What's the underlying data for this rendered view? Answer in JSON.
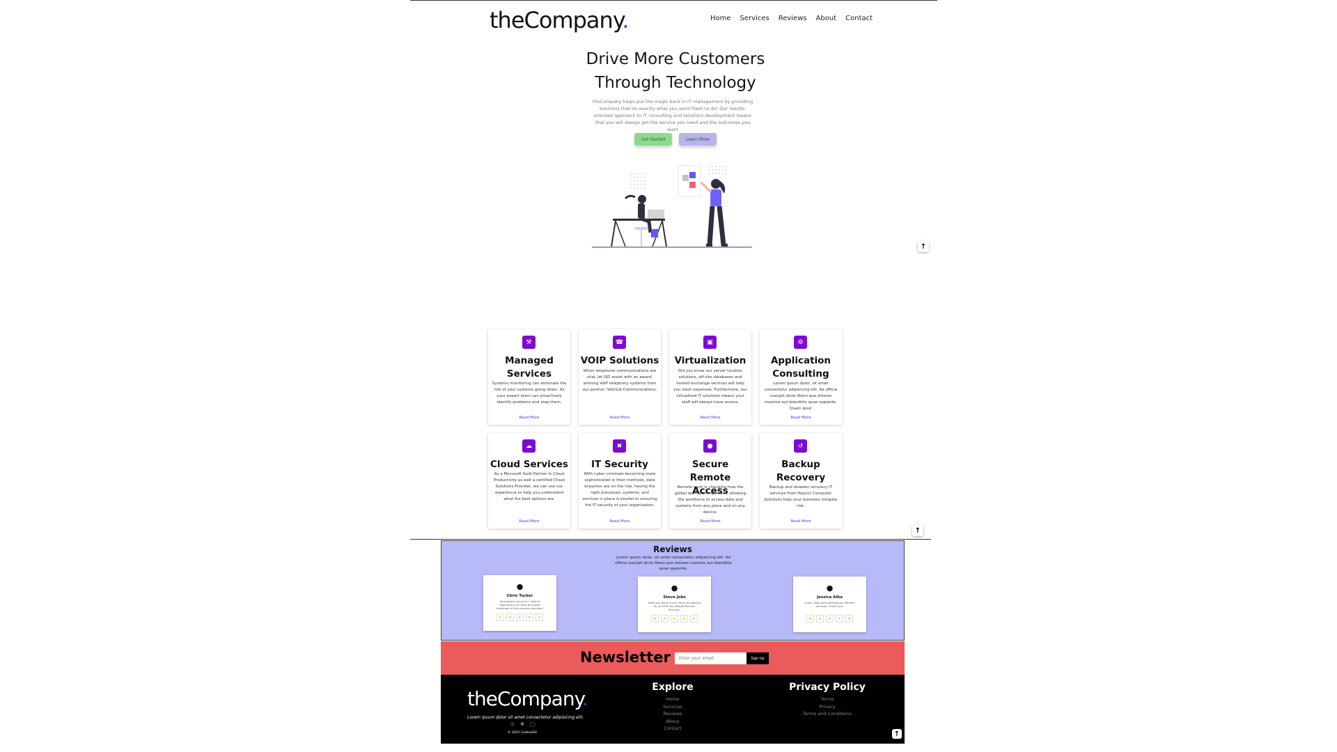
{
  "header": {
    "logo_text": "theCompany",
    "logo_dot": ".",
    "nav": [
      "Home",
      "Services",
      "Reviews",
      "About",
      "Contact"
    ]
  },
  "hero": {
    "title_line1": "Drive More Customers",
    "title_line2": "Through Technology",
    "text": "theCompany helps put the magic back in IT management by providing solutions that do exactly what you want them to do! Our results-oriented approach to IT consulting and solutions development means that you will always get the service you need and the outcomes you want",
    "btn_primary": "Get Started",
    "btn_secondary": "Learn More"
  },
  "services": [
    {
      "icon": "wrench-icon",
      "glyph": "⚒",
      "title": "Managed Services",
      "desc": "Systems monitoring can eliminate the risk of your systems going down. As your expert team can proactively identify problems and stop them.",
      "more": "Read More"
    },
    {
      "icon": "phone-icon",
      "glyph": "☎",
      "title": "VOIP Solutions",
      "desc": "When telephone communications are vital, let ISD assist with an award-winning VoIP telephony systems from our partner, Vertical Communications.",
      "more": "Read More"
    },
    {
      "icon": "server-icon",
      "glyph": "▣",
      "title": "Virtualization",
      "desc": "Did you know our server location solutions, off-site databases and hosted exchange services will help you slash expenses. Furthermore, our virtualized IT solutions means your staff will always have access.",
      "more": "Read More"
    },
    {
      "icon": "gear-icon",
      "glyph": "⚙",
      "title": "Application Consulting",
      "desc": "Lorem ipsum dolor, sit amet consectetur adipisicing elit. Ad officia suscipit dicta libero quo dolores maxime aut blanditiis quae sapiente. Quam ipsa!",
      "more": "Read More"
    },
    {
      "icon": "cloud-icon",
      "glyph": "☁",
      "title": "Cloud Services",
      "desc": "As a Microsoft Gold Partner in Cloud Productivity as well a certified Cloud Solutions Provider, we can use our experience to help you understand what the best options are.",
      "more": "Read More"
    },
    {
      "icon": "shield-icon",
      "glyph": "✖",
      "title": "IT Security",
      "desc": "With cyber criminals becoming more sophisticated in their methods, data breaches are on the rise, having the right processes, systems, and services in place is pivotal to ensuring the IT security of your organization.",
      "more": "Read More"
    },
    {
      "icon": "lock-icon",
      "glyph": "●",
      "title": "Secure Remote Access",
      "desc": "Remote work is changing how the global workspace operates, allowing the workforce to access data and systems from any place and on any device.",
      "more": "Read More"
    },
    {
      "icon": "backup-icon",
      "glyph": "↺",
      "title": "Backup Recovery",
      "desc": "Backup and disaster recovery IT services from Haycor Computer Solutions help your business mitigate risk.",
      "more": "Read More"
    }
  ],
  "reviews": {
    "title": "Reviews",
    "subtitle": "Lorem ipsum dolor, sit amet consectetur adipisicing elit. Ad officia suscipit dicta libero quo dolores maxime aut blanditiis quae sapiente.",
    "items": [
      {
        "name": "Chris Tucker",
        "text": "Exceptional services! I rated it expecting such facts and good treatment of the services provided.",
        "stars": [
          "★",
          "★",
          "★",
          "★",
          "★"
        ]
      },
      {
        "name": "Steve Jobs",
        "text": "Have you given it any rating as good as for all VoIP, the offered Remote Services.",
        "stars": [
          "★",
          "★",
          "★",
          "★",
          "★"
        ]
      },
      {
        "name": "Jessica Alba",
        "text": "Quick, easy and professional, Reliable services. Thank you!",
        "stars": [
          "★",
          "★",
          "★",
          "★",
          "★"
        ]
      }
    ]
  },
  "newsletter": {
    "title": "Newsletter",
    "placeholder": "Enter your email",
    "button": "Sign Up"
  },
  "footer": {
    "logo_text": "theCompany",
    "logo_dot": ".",
    "tagline": "Lorem ipsum dolor sit amet consectetur adipisicing elit.",
    "copyright": "© 2023 CodeasDit",
    "explore_title": "Explore",
    "explore_links": [
      "Home",
      "Services",
      "Reviews",
      "About",
      "Contact"
    ],
    "privacy_title": "Privacy Policy",
    "privacy_links": [
      "Terms",
      "Privacy",
      "Terms and Conditions"
    ],
    "social": [
      "◎",
      "✱",
      "◯"
    ]
  },
  "scroll_top_glyph": "↑",
  "colors": {
    "accent": "#7d0bd1",
    "link": "#3d43e0",
    "reviews_bg": "#b8b9f9",
    "newsletter_bg": "#ec5b5b",
    "footer_bg": "#000000",
    "btn_primary": "#8ed98e",
    "btn_secondary": "#b7b4e6"
  }
}
